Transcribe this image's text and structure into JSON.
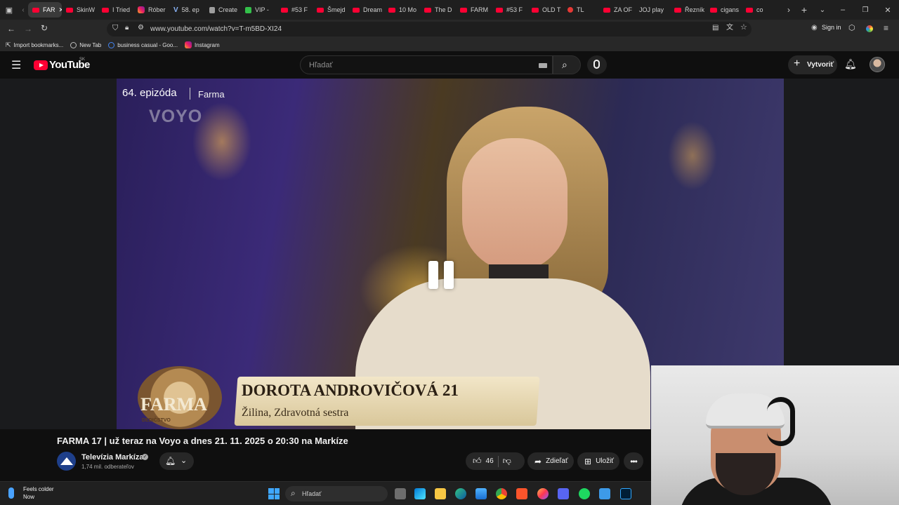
{
  "browser": {
    "tabs": [
      {
        "title": "FAR",
        "favicon": "youtube-icon",
        "active": true
      },
      {
        "title": "SkinW",
        "favicon": "youtube-icon"
      },
      {
        "title": "I Tried",
        "favicon": "youtube-icon"
      },
      {
        "title": "Róber",
        "favicon": "instagram-icon"
      },
      {
        "title": "58. ep",
        "favicon": "voyo-icon"
      },
      {
        "title": "Create",
        "favicon": "document-icon"
      },
      {
        "title": "VIP - ",
        "favicon": "vip-icon"
      },
      {
        "title": "#53 F",
        "favicon": "youtube-icon"
      },
      {
        "title": "Šmejd",
        "favicon": "youtube-icon"
      },
      {
        "title": "Dream",
        "favicon": "youtube-icon"
      },
      {
        "title": "10 Mo",
        "favicon": "youtube-icon"
      },
      {
        "title": "The D",
        "favicon": "youtube-icon"
      },
      {
        "title": "FARM",
        "favicon": "youtube-icon"
      },
      {
        "title": "#53 F",
        "favicon": "youtube-icon"
      },
      {
        "title": "OLD T",
        "favicon": "youtube-icon"
      },
      {
        "title": "TL",
        "favicon": "record-icon"
      },
      {
        "title": "ZA OF",
        "favicon": "youtube-icon"
      },
      {
        "title": "JOJ play",
        "favicon": "none"
      },
      {
        "title": "Řezník",
        "favicon": "youtube-icon"
      },
      {
        "title": "cigans",
        "favicon": "youtube-icon"
      },
      {
        "title": "co",
        "favicon": "youtube-icon"
      }
    ],
    "url": "www.youtube.com/watch?v=T-m5BD-XI24",
    "sign_in": "Sign in",
    "bookmarks": [
      {
        "label": "Import bookmarks...",
        "icon": "import-icon"
      },
      {
        "label": "New Tab",
        "icon": "globe-icon"
      },
      {
        "label": "business casual - Goo...",
        "icon": "google-icon"
      },
      {
        "label": "Instagram",
        "icon": "instagram-icon"
      }
    ]
  },
  "youtube": {
    "logo_text": "YouTube",
    "region": "SK",
    "search_placeholder": "Hľadať",
    "create_label": "Vytvoriť"
  },
  "video": {
    "episode_label": "64. epizóda",
    "show_name": "Farma",
    "watermark": "VOYO",
    "lower_third_name": "DOROTA ANDROVIČOVÁ 21",
    "lower_third_sub": "Žilina, Zdravotná sestra",
    "logo_text": "FARMA",
    "logo_sub": "DEDIČSTVO",
    "title": "FARMA 17 | už teraz na Voyo a dnes 21. 11. 2025 o 20:30 na Markíze",
    "state": "paused"
  },
  "channel": {
    "name": "Televízia Markíza",
    "subscribers": "1,74 mil. odberateľov",
    "verified": true
  },
  "actions": {
    "likes": "46",
    "share_label": "Zdieľať",
    "save_label": "Uložiť"
  },
  "taskbar": {
    "weather_title": "Feels colder",
    "weather_sub": "Now",
    "search_placeholder": "Hľadať",
    "apps": [
      "start-icon",
      "task-view-icon",
      "store-icon",
      "file-explorer-icon",
      "edge-icon",
      "photos-icon",
      "chrome-icon",
      "brave-icon",
      "firefox-icon",
      "discord-icon",
      "spotify-icon",
      "notepad-icon",
      "photoshop-icon"
    ]
  },
  "colors": {
    "youtube_red": "#ff0033",
    "background": "#0f0f0f",
    "surface": "#272727"
  }
}
